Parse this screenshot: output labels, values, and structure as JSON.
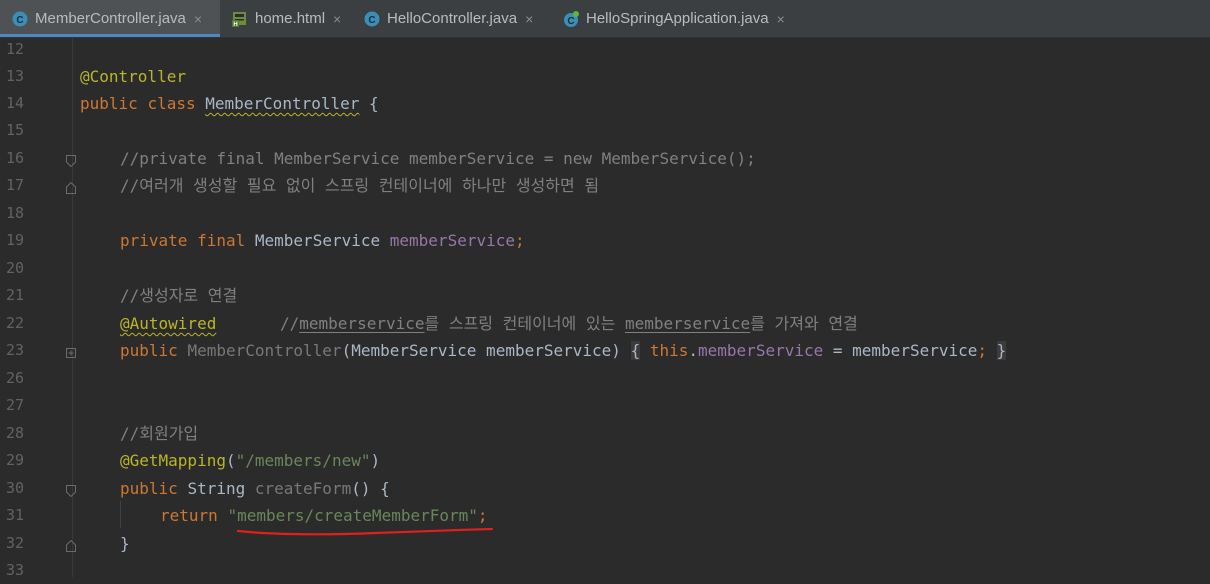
{
  "tabs": [
    {
      "label": "MemberController.java",
      "icon": "java-class-icon",
      "active": true
    },
    {
      "label": "home.html",
      "icon": "html-file-icon",
      "active": false
    },
    {
      "label": "HelloController.java",
      "icon": "java-class-icon",
      "active": false
    },
    {
      "label": "HelloSpringApplication.java",
      "icon": "spring-app-icon",
      "active": false
    }
  ],
  "close_glyph": "×",
  "lines": [
    {
      "num": "12"
    },
    {
      "num": "13",
      "annotation": "@Controller"
    },
    {
      "num": "14",
      "kw1": "public",
      "kw2": "class",
      "class_name": "MemberController",
      "brace": "{"
    },
    {
      "num": "15"
    },
    {
      "num": "16",
      "comment": "//private final MemberService memberService = new MemberService();"
    },
    {
      "num": "17",
      "comment": "//여러개 생성할 필요 없이 스프링 컨테이너에 하나만 생성하면 됨"
    },
    {
      "num": "18"
    },
    {
      "num": "19",
      "kw1": "private",
      "kw2": "final",
      "type": "MemberService",
      "field": "memberService",
      "semi": ";"
    },
    {
      "num": "20"
    },
    {
      "num": "21",
      "comment": "//생성자로 연결"
    },
    {
      "num": "22",
      "annotation": "@Autowired",
      "comment_pre": "//",
      "comment_word1": "memberservice",
      "comment_mid": "를 스프링 컨테이너에 있는 ",
      "comment_word2": "memberservice",
      "comment_post": "를 가져와 연결"
    },
    {
      "num": "23",
      "kw1": "public",
      "ctor": "MemberController",
      "params": "(MemberService memberService)",
      "open": "{",
      "this": "this",
      "dot": ".",
      "field": "memberService",
      "assign": " = memberService",
      "semi": ";",
      "close": "}"
    },
    {
      "num": "26"
    },
    {
      "num": "27"
    },
    {
      "num": "28",
      "comment": "//회원가입"
    },
    {
      "num": "29",
      "annotation": "@GetMapping",
      "lp": "(",
      "path": "\"/members/new\"",
      "rp": ")"
    },
    {
      "num": "30",
      "kw1": "public",
      "type": "String",
      "method": "createForm",
      "rest": "() {"
    },
    {
      "num": "31",
      "kw1": "return",
      "str": "\"members/createMemberForm\"",
      "semi": ";"
    },
    {
      "num": "32",
      "brace": "}"
    },
    {
      "num": "33"
    }
  ],
  "colors": {
    "background": "#2b2b2b",
    "keyword": "#cc7832",
    "annotation": "#bbb529",
    "comment": "#808080",
    "string": "#6a8759",
    "field": "#9876aa",
    "red_underline": "#e0201c"
  }
}
